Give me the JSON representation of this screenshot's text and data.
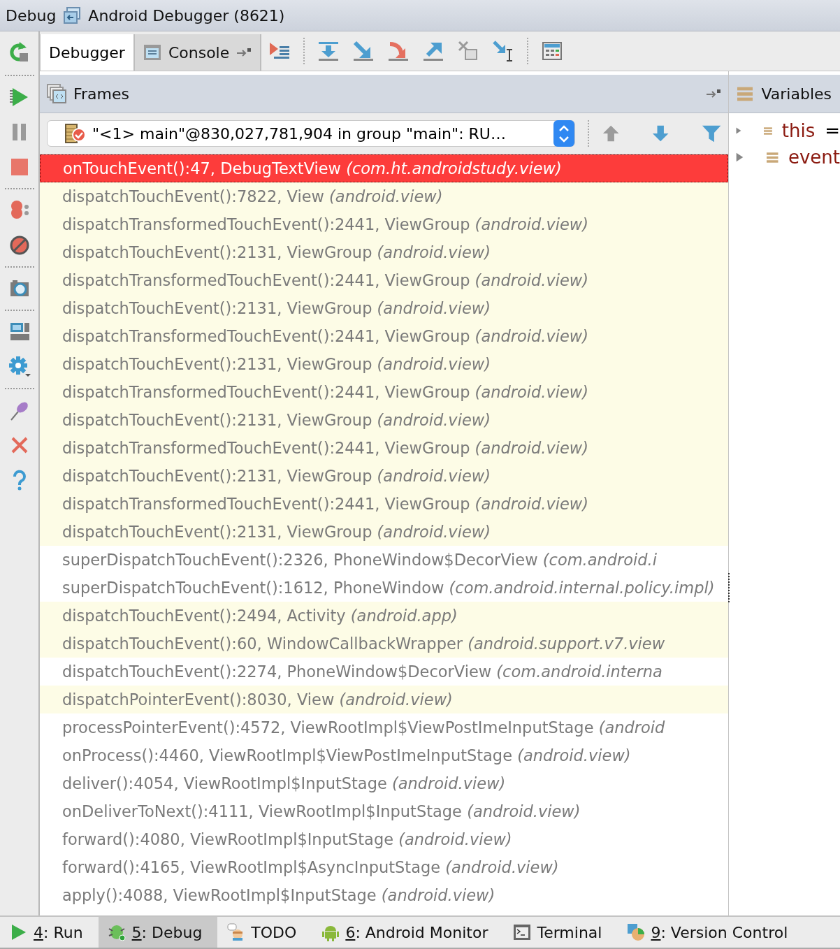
{
  "title_bar": {
    "tool": "Debug",
    "session": "Android Debugger (8621)"
  },
  "tabs": [
    {
      "label": "Debugger",
      "selected": true
    },
    {
      "label": "Console",
      "selected": false
    }
  ],
  "frames": {
    "title": "Frames",
    "thread": "\"<1> main\"@830,027,781,904 in group \"main\": RU…",
    "rows": [
      {
        "text": "onTouchEvent():47, DebugTextView *(com.ht.androidstudy.view)*",
        "selected": true,
        "expanded": false
      },
      {
        "text": "dispatchTouchEvent():7822, View *(android.view)*",
        "selected": false,
        "tinted": true,
        "expanded": false
      },
      {
        "text": "dispatchTransformedTouchEvent():2441, ViewGroup *(android.view)*",
        "selected": false,
        "tinted": true,
        "expanded": false
      },
      {
        "text": "dispatchTouchEvent():2131, ViewGroup *(android.view)*",
        "selected": false,
        "tinted": true,
        "expanded": false
      },
      {
        "text": "dispatchTransformedTouchEvent():2441, ViewGroup *(android.view)*",
        "selected": false,
        "tinted": true,
        "expanded": false
      },
      {
        "text": "dispatchTouchEvent():2131, ViewGroup *(android.view)*",
        "selected": false,
        "tinted": true,
        "expanded": false
      },
      {
        "text": "dispatchTransformedTouchEvent():2441, ViewGroup *(android.view)*",
        "selected": false,
        "tinted": true,
        "expanded": false
      },
      {
        "text": "dispatchTouchEvent():2131, ViewGroup *(android.view)*",
        "selected": false,
        "tinted": true,
        "expanded": false
      },
      {
        "text": "dispatchTransformedTouchEvent():2441, ViewGroup *(android.view)*",
        "selected": false,
        "tinted": true,
        "expanded": false
      },
      {
        "text": "dispatchTouchEvent():2131, ViewGroup *(android.view)*",
        "selected": false,
        "tinted": true,
        "expanded": false
      },
      {
        "text": "dispatchTransformedTouchEvent():2441, ViewGroup *(android.view)*",
        "selected": false,
        "tinted": true,
        "expanded": false
      },
      {
        "text": "dispatchTouchEvent():2131, ViewGroup *(android.view)*",
        "selected": false,
        "tinted": true,
        "expanded": false
      },
      {
        "text": "dispatchTransformedTouchEvent():2441, ViewGroup *(android.view)*",
        "selected": false,
        "tinted": true,
        "expanded": false
      },
      {
        "text": "dispatchTouchEvent():2131, ViewGroup *(android.view)*",
        "selected": false,
        "tinted": true,
        "expanded": false
      },
      {
        "text": "superDispatchTouchEvent():2326, PhoneWindow$DecorView *(com.android.i*",
        "selected": false,
        "tinted": false,
        "expanded": false
      },
      {
        "text": "superDispatchTouchEvent():1612, PhoneWindow *(com.android.internal.policy.impl)*",
        "selected": false,
        "tinted": false,
        "expanded": true
      },
      {
        "text": "dispatchTouchEvent():2494, Activity *(android.app)*",
        "selected": false,
        "tinted": true,
        "expanded": false
      },
      {
        "text": "dispatchTouchEvent():60, WindowCallbackWrapper *(android.support.v7.view*",
        "selected": false,
        "tinted": true,
        "expanded": false
      },
      {
        "text": "dispatchTouchEvent():2274, PhoneWindow$DecorView *(com.android.interna*",
        "selected": false,
        "tinted": false,
        "expanded": false
      },
      {
        "text": "dispatchPointerEvent():8030, View *(android.view)*",
        "selected": false,
        "tinted": true,
        "expanded": false
      },
      {
        "text": "processPointerEvent():4572, ViewRootImpl$ViewPostImeInputStage *(android*",
        "selected": false,
        "tinted": false,
        "expanded": false
      },
      {
        "text": "onProcess():4460, ViewRootImpl$ViewPostImeInputStage *(android.view)*",
        "selected": false,
        "tinted": false,
        "expanded": false
      },
      {
        "text": "deliver():4054, ViewRootImpl$InputStage *(android.view)*",
        "selected": false,
        "tinted": false,
        "expanded": false
      },
      {
        "text": "onDeliverToNext():4111, ViewRootImpl$InputStage *(android.view)*",
        "selected": false,
        "tinted": false,
        "expanded": false
      },
      {
        "text": "forward():4080, ViewRootImpl$InputStage *(android.view)*",
        "selected": false,
        "tinted": false,
        "expanded": false
      },
      {
        "text": "forward():4165, ViewRootImpl$AsyncInputStage *(android.view)*",
        "selected": false,
        "tinted": false,
        "expanded": false
      },
      {
        "text": "apply():4088, ViewRootImpl$InputStage *(android.view)*",
        "selected": false,
        "tinted": false,
        "expanded": false
      }
    ]
  },
  "variables": {
    "title": "Variables",
    "items": [
      {
        "name": "this",
        "suffix": "="
      },
      {
        "name": "event"
      }
    ]
  },
  "tool_windows": [
    {
      "kind": "run",
      "mnemonic": "4",
      "label": ": Run",
      "selected": false
    },
    {
      "kind": "debug",
      "mnemonic": "5",
      "label": ": Debug",
      "selected": true
    },
    {
      "kind": "todo",
      "label": "TODO",
      "selected": false
    },
    {
      "kind": "android",
      "mnemonic": "6",
      "label": ": Android Monitor",
      "selected": false
    },
    {
      "kind": "terminal",
      "label": "Terminal",
      "selected": false
    },
    {
      "kind": "vcs",
      "mnemonic": "9",
      "label": ": Version Control",
      "selected": false
    }
  ]
}
